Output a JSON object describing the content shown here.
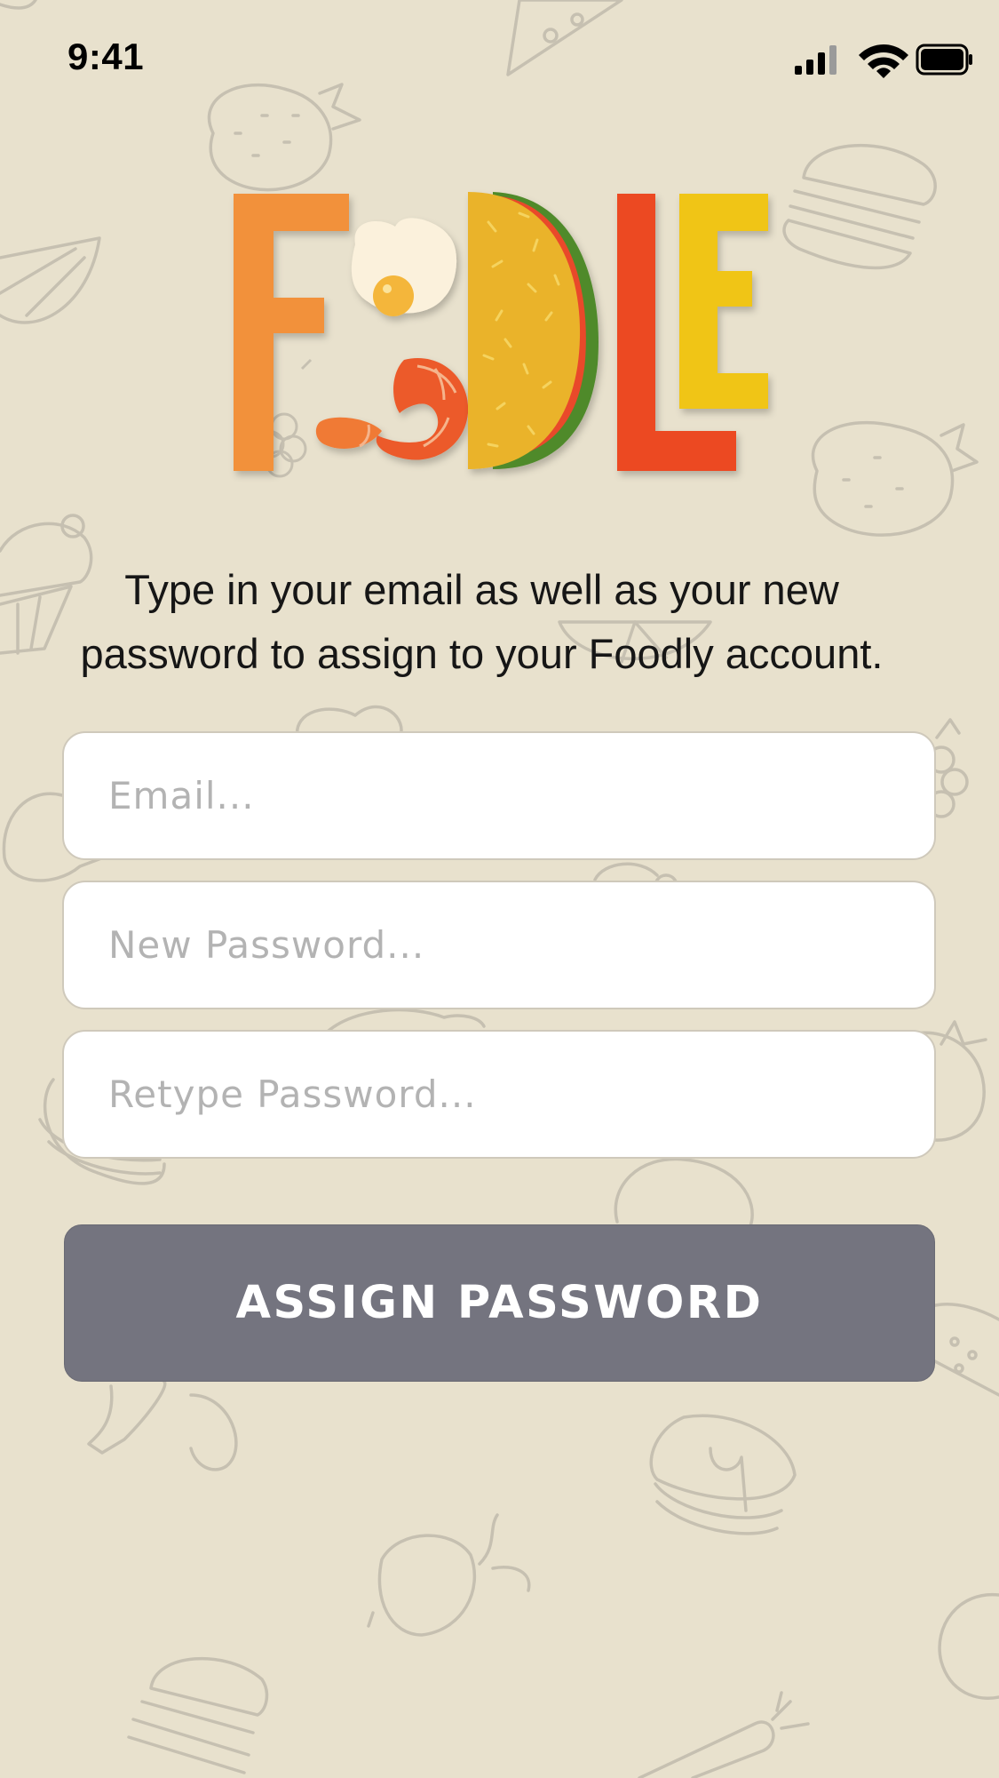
{
  "status_bar": {
    "time": "9:41",
    "icons": [
      "cellular-signal-icon",
      "wifi-icon",
      "battery-icon"
    ]
  },
  "logo": {
    "name": "FOODLE",
    "letters": [
      "F",
      "egg",
      "shrimp",
      "taco",
      "L",
      "E"
    ],
    "colors": {
      "f": "#f2913a",
      "l": "#ec4a23",
      "e": "#f0c519",
      "taco": "#eab32a"
    }
  },
  "instruction": "Type in your email as well as your new password to assign to your Foodly account.",
  "form": {
    "email": {
      "value": "",
      "placeholder": "Email..."
    },
    "new_password": {
      "value": "",
      "placeholder": "New Password..."
    },
    "retype_password": {
      "value": "",
      "placeholder": "Retype Password..."
    },
    "submit_label": "ASSIGN PASSWORD"
  },
  "theme": {
    "background": "#e8e1cd",
    "button": "#74747f",
    "button_text": "#ffffff",
    "placeholder": "#b3b3b3",
    "doodle_stroke": "#c6c0b1"
  }
}
